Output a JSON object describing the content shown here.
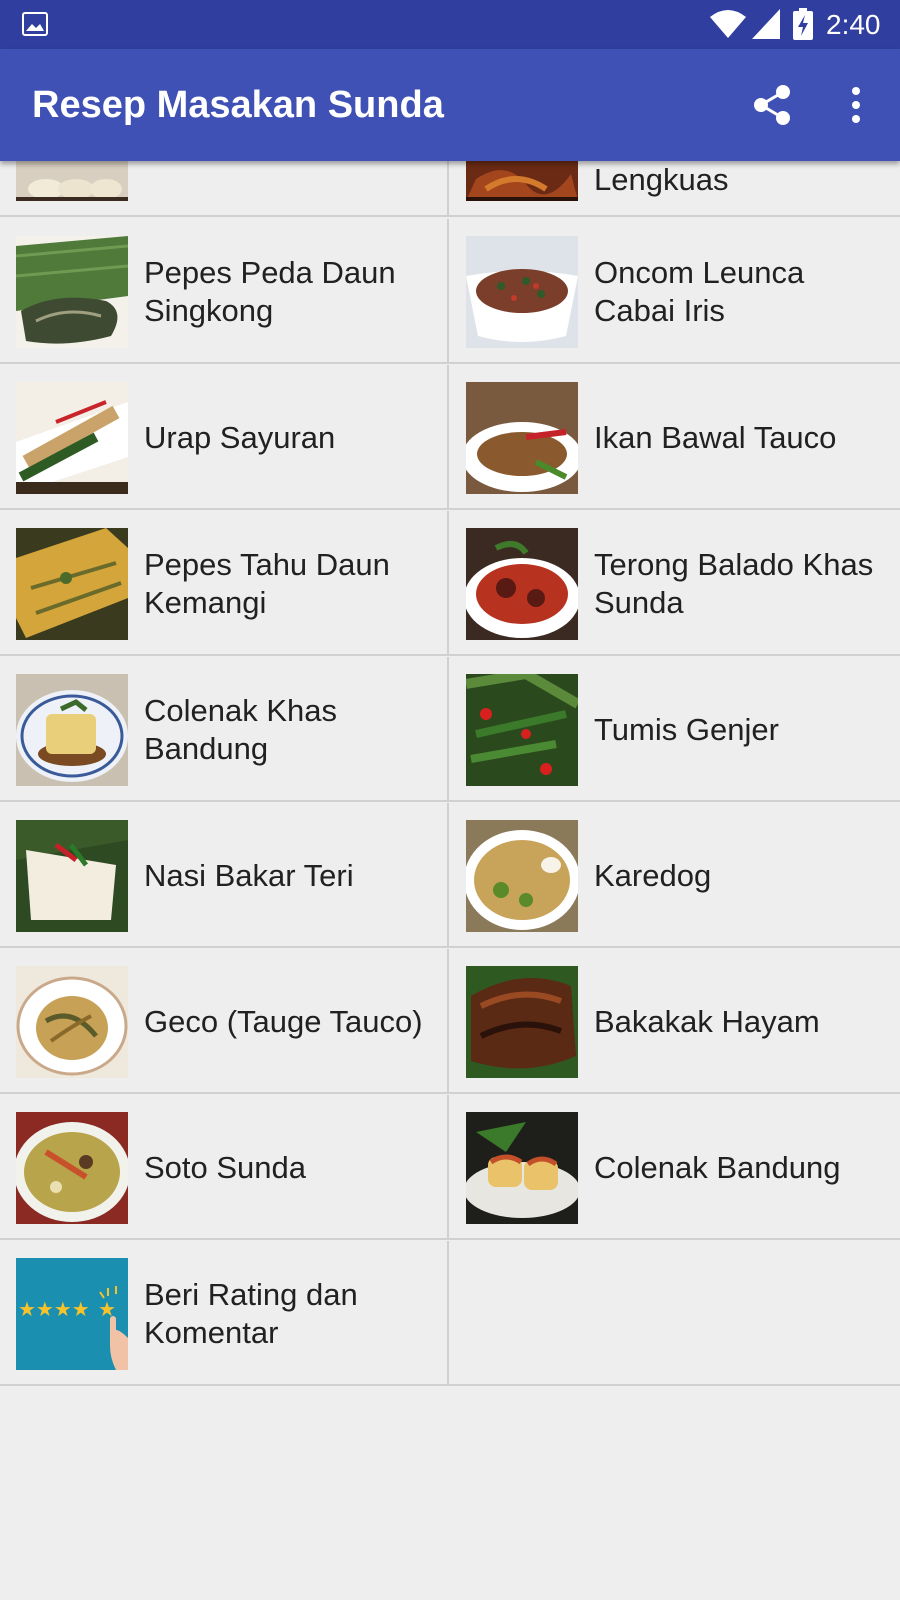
{
  "status_bar": {
    "time": "2:40"
  },
  "app_bar": {
    "title": "Resep Masakan Sunda"
  },
  "partial_row": {
    "left_label": "",
    "right_label": "Lengkuas"
  },
  "recipes": [
    {
      "left": "Pepes Peda Daun Singkong",
      "right": "Oncom Leunca Cabai Iris"
    },
    {
      "left": "Urap Sayuran",
      "right": "Ikan Bawal Tauco"
    },
    {
      "left": "Pepes Tahu Daun Kemangi",
      "right": "Terong Balado Khas Sunda"
    },
    {
      "left": "Colenak Khas Bandung",
      "right": "Tumis Genjer"
    },
    {
      "left": "Nasi Bakar Teri",
      "right": "Karedog"
    },
    {
      "left": "Geco (Tauge Tauco)",
      "right": "Bakakak Hayam"
    },
    {
      "left": "Soto Sunda",
      "right": "Colenak Bandung"
    },
    {
      "left": "Beri Rating dan Komentar",
      "right": ""
    }
  ],
  "colors": {
    "status_bar": "#303f9f",
    "app_bar": "#3f51b5",
    "background": "#eeeeee"
  }
}
